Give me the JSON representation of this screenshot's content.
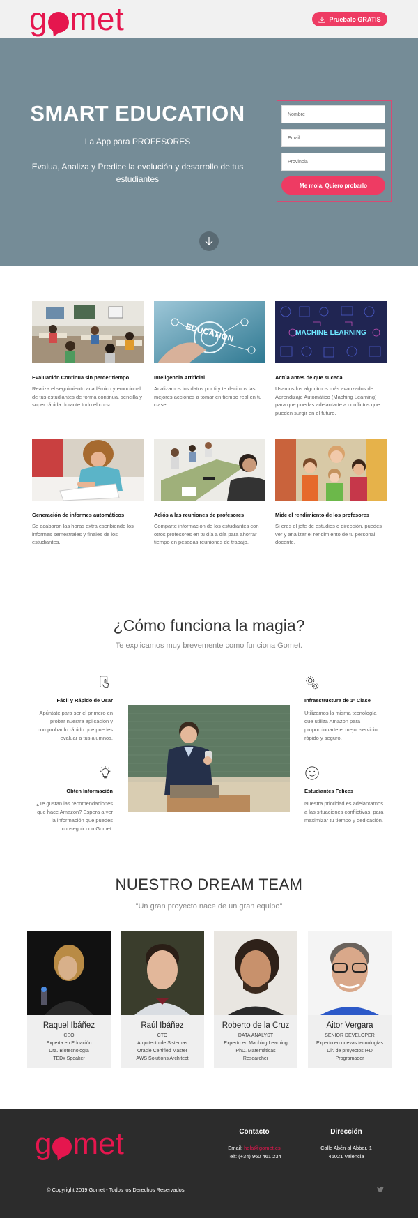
{
  "header": {
    "logo_text_1": "g",
    "logo_text_2": "met",
    "try_button": "Pruebalo GRATIS"
  },
  "hero": {
    "title": "SMART EDUCATION",
    "subtitle": "La App para PROFESORES",
    "description": "Evalua, Analiza y Predice la evolución y desarrollo de tus estudiantes",
    "form": {
      "name_placeholder": "Nombre",
      "email_placeholder": "Email",
      "province_placeholder": "Provincia",
      "submit": "Me mola. Quiero probarlo"
    }
  },
  "features": [
    {
      "title": "Evaluación Continua sin perder tiempo",
      "text": "Realiza el seguimiento académico y emocional de tus estudiantes de forma continua, sencilla y super rápida durante todo el curso."
    },
    {
      "title": "Inteligencia Artificial",
      "text": "Analizamos los datos por ti y te decimos las mejores acciones a tomar en tiempo real en tu clase.",
      "img_label": "EDUCATION"
    },
    {
      "title": "Actúa antes de que suceda",
      "text": "Usamos los algoritmos más avanzados de Aprendizaje Automático (Maching Learning) para que puedas adelantarte a conflictos que pueden surgir en el futuro.",
      "img_label": "MACHINE LEARNING"
    },
    {
      "title": "Generación de informes automáticos",
      "text": "Se acabaron las horas extra escribiendo los informes semestrales y finales de los estudiantes."
    },
    {
      "title": "Adiós a las reuniones de profesores",
      "text": "Comparte información de los estudiantes con otros profesores en tu día a día para ahorrar tiempo en pesadas reuniones de trabajo."
    },
    {
      "title": "Mide el rendimiento de los profesores",
      "text": "Si eres el jefe de estudios o dirección, puedes ver y analizar el rendimiento de tu personal docente."
    }
  ],
  "magic": {
    "title": "¿Cómo funciona la magia?",
    "subtitle": "Te explicamos muy brevemente como funciona Gomet.",
    "items": [
      {
        "title": "Fácil y Rápido de Usar",
        "text": "Apúntate para ser el primero en probar nuestra aplicación y comprobar lo rápido que puedes evaluar a tus alumnos.",
        "icon": "touch-screen-icon"
      },
      {
        "title": "Obtén Información",
        "text": "¿Te gustan las recomendaciones que hace Amazon? Espera a ver la información que puedes conseguir con Gomet.",
        "icon": "lightbulb-icon"
      },
      {
        "title": "Infraestructura de 1ª Clase",
        "text": "Utilizamos la misma tecnología que utiliza Amazon para proporcionarte el mejor servicio, rápido y seguro.",
        "icon": "gears-icon"
      },
      {
        "title": "Estudiantes Felices",
        "text": "Nuestra prioridad es adelantarnos a las situaciones conflictivas, para maximizar tu tiempo y dedicación.",
        "icon": "smiley-icon"
      }
    ]
  },
  "team": {
    "title": "NUESTRO DREAM TEAM",
    "subtitle": "\"Un gran proyecto nace de un gran equipo\"",
    "members": [
      {
        "name": "Raquel Ibáñez",
        "lines": [
          "CEO",
          "Experta en Eduación",
          "Dra. Biotecnología",
          "TEDx Speaker"
        ]
      },
      {
        "name": "Raúl Ibáñez",
        "lines": [
          "CTO",
          "Arquitecto de Sistemas",
          "Oracle Certified Master",
          "AWS Solutions Architect"
        ]
      },
      {
        "name": "Roberto de la Cruz",
        "lines": [
          "DATA ANALYST",
          "Experto en Maching Learning",
          "PhD. Matemáticas",
          "Researcher"
        ]
      },
      {
        "name": "Aitor Vergara",
        "lines": [
          "SENIOR DEVELOPER",
          "Experto en nuevas tecnologías",
          "Dir. de proyectos I+D",
          "Programador"
        ]
      }
    ]
  },
  "footer": {
    "contact_title": "Contacto",
    "email_label": "Email: ",
    "email_value": "hola@gomet.es",
    "phone": "Telf: (+34) 960 461 234",
    "address_title": "Dirección",
    "address_1": "Calle Abén al Abbar, 1",
    "address_2": "46021 Valencia",
    "copyright": "© Copyright 2019 Gomet - Todos los Derechos Reservados"
  },
  "colors": {
    "brand": "#e5164e",
    "button": "#ee3b63",
    "hero_bg": "#758c97",
    "footer_bg": "#2c2c2c"
  }
}
